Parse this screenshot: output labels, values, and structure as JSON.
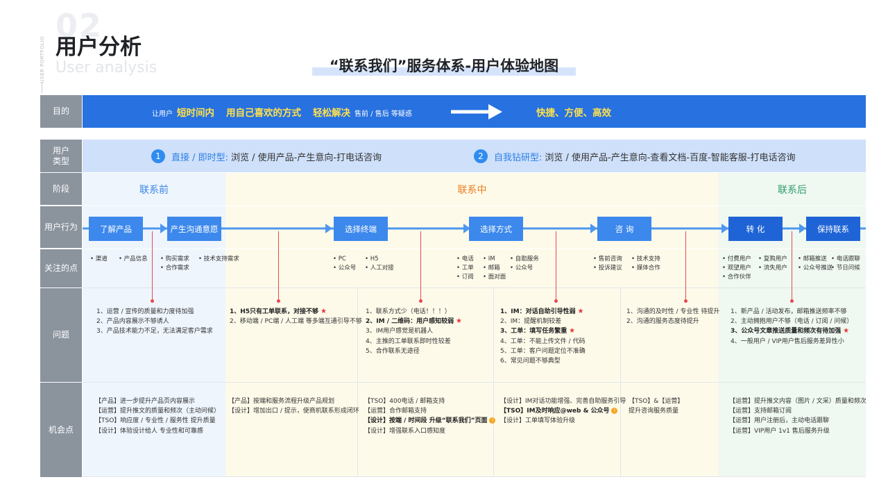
{
  "header": {
    "section_number": "02",
    "vertical_text": "USER PORTFOLIO",
    "title": "用户分析",
    "subtitle": "User analysis",
    "map_title": "“联系我们”服务体系-用户体验地图"
  },
  "row_labels": {
    "goal": "目的",
    "user_type_line1": "用户",
    "user_type_line2": "类型",
    "stage": "阶段",
    "behavior": "用户行为",
    "focus": "关注的点",
    "problem": "问题",
    "opportunity": "机会点"
  },
  "goal": {
    "prefix": "让用户",
    "kw1": "短时间内",
    "kw2": "用自己喜欢的方式",
    "kw3": "轻松解决",
    "suffix": "售前 / 售后 等疑惑",
    "result": "快捷、方便、高效"
  },
  "user_types": [
    {
      "num": "1",
      "name": "直接 / 即时型:",
      "desc": "浏览 / 使用产品-产生意向-打电话咨询"
    },
    {
      "num": "2",
      "name": "自我钻研型:",
      "desc": "浏览 / 使用产品-产生意向-查看文档-百度-智能客服-打电话咨询"
    }
  ],
  "stages": {
    "before": "联系前",
    "during": "联系中",
    "after": "联系后"
  },
  "behaviors": [
    "了解产品",
    "产生沟通意愿",
    "选择终端",
    "选择方式",
    "咨 询",
    "转 化",
    "保持联系"
  ],
  "focus": {
    "c1": [
      "渠道",
      "产品信息"
    ],
    "c2": [
      "购买需求",
      "合作需求"
    ],
    "c3": [
      "技术支持需求"
    ],
    "c4a": [
      "PC",
      "公众号"
    ],
    "c4b": [
      "H5",
      "人工对接"
    ],
    "c5a": [
      "电话",
      "工单",
      "订阅"
    ],
    "c5b": [
      "IM",
      "邮箱",
      "面对面"
    ],
    "c5c": [
      "自助服务",
      "公众号"
    ],
    "c6a": [
      "售前咨询",
      "投诉建议"
    ],
    "c6b": [
      "技术支持",
      "媒体合作"
    ],
    "c7a": [
      "付费用户",
      "观望用户",
      "合作伙伴"
    ],
    "c7b": [
      "复购用户",
      "流失用户"
    ],
    "c8a": [
      "邮箱推送",
      "公众号推送"
    ],
    "c8b": [
      "电话跟聊",
      "节日问候"
    ]
  },
  "problems": {
    "col1": [
      "1、运营 / 宣传的质量和力度待加强",
      "2、产品内容展示不够诱人",
      "3、产品技术能力不足，无法满足客户需求"
    ],
    "col2": [
      "1、H5只有工单联系，对接不够",
      "2、移动端 / PC端 / 人工端 等多端互通引导不够"
    ],
    "col3": [
      "1、联系方式少（电话！！！）",
      "2、IM / 二维码：用户感知较弱",
      "3、IM用户感觉是机器人",
      "4、主推的工单联系即时性较差",
      "5、合作联系无途径"
    ],
    "col4": [
      "1、IM：对话自助引导性弱",
      "2、IM：提醒机制较差",
      "3、工单：填写任务繁重",
      "4、工单：不能上传文件 / 代码",
      "5、工单：客户问题定位不准确",
      "6、常见问题不够典型"
    ],
    "col5": [
      "1、沟通的及时性 / 专业性 待提升",
      "2、沟通的服务态度待提升"
    ],
    "col6": [
      "1、新产品 / 活动发布，邮箱推送频率不够",
      "2、主动拥抱用户不够（电话 / 订阅 / 问候）",
      "3、公众号文章推送质量和频次有待加强",
      "4、一般用户 / VIP用户售后服务差异性小"
    ]
  },
  "opportunities": {
    "col1": [
      "【产品】进一步提升产品页内容展示",
      "【运营】提升推文的质量和频次（主动问候）",
      "【TSO】响应度 / 专业性 / 服务性 提升质量",
      "【设计】体验设计给人 专业性和可靠感"
    ],
    "col2": [
      "【产品】按端和服务流程升级产品规划",
      "【设计】增加出口 / 提示，使商机联系形成闭环"
    ],
    "col3": [
      "【TSO】400电话 / 邮箱支持",
      "【运营】合作邮箱支持",
      "【设计】按端 / 时间段 升级“联系我们”页面",
      "【设计】增强联系入口感知度"
    ],
    "col4": [
      "【设计】IM对话功能增强、完善自助服务引导",
      "【TSO】IM及时响应@web & 公众号",
      "【设计】工单填写体验升级"
    ],
    "col5": [
      "【TSO】&【运营】",
      "提升咨询服务质量"
    ],
    "col6": [
      "【运营】提升推文内容（图片 / 文采）质量和频次",
      "【运营】支持邮箱订阅",
      "【运营】用户注册后，主动电话跟聊",
      "【运营】VIP用户 1v1 售后服务升级"
    ]
  },
  "colors": {
    "label_gray": "#8b939d",
    "goal_blue": "#2771e0",
    "highlight_yellow": "#ffe14d",
    "type_bg": "#cfe0fa",
    "before_bg": "#eef5fd",
    "during_bg": "#fdfaea",
    "after_bg": "#eff8f1",
    "stage_before": "#3a86e6",
    "stage_during": "#ee7d20",
    "stage_after": "#2e9d6b",
    "star_red": "#e53935"
  }
}
